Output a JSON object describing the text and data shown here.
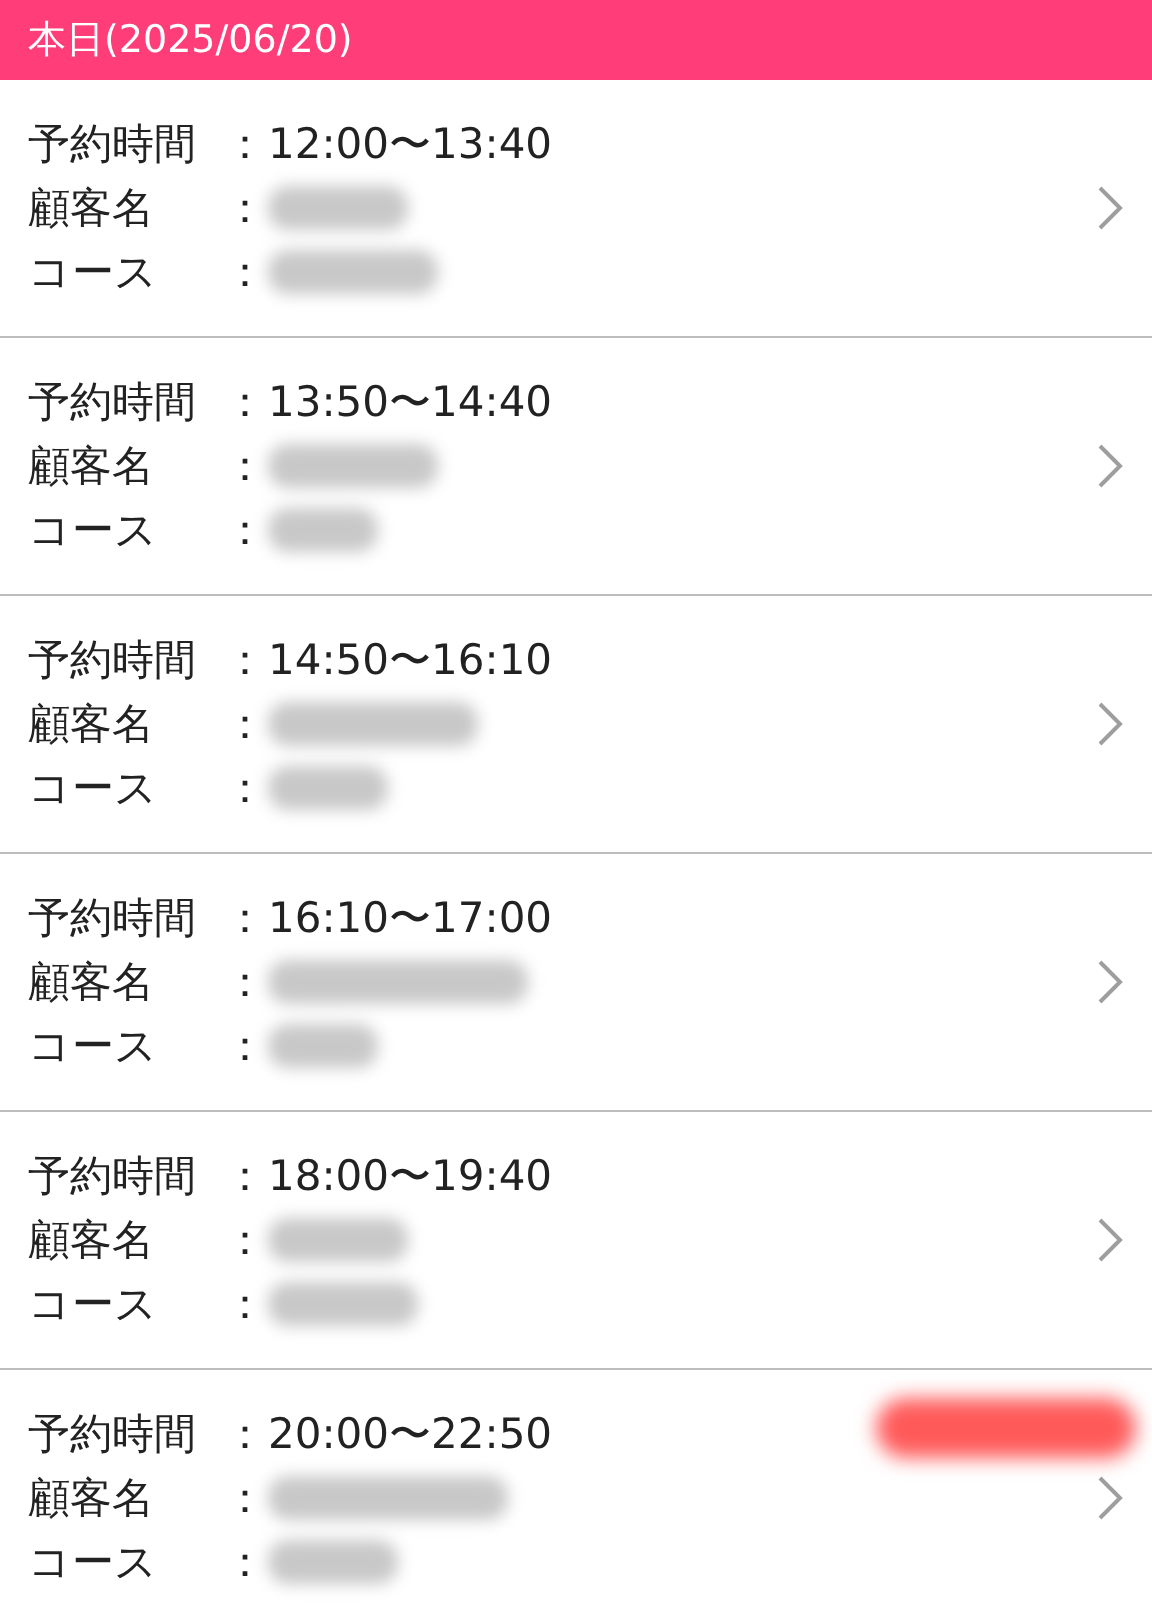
{
  "header": {
    "title": "本日(2025/06/20)"
  },
  "reservations": [
    {
      "time_label": "予約時間",
      "colon": "：",
      "time": "12:00〜13:40",
      "name_label": "顧客名",
      "course_label": "コース",
      "has_badge": false
    },
    {
      "time_label": "予約時間",
      "colon": "：",
      "time": "13:50〜14:40",
      "name_label": "顧客名",
      "course_label": "コース",
      "has_badge": false
    },
    {
      "time_label": "予約時間",
      "colon": "：",
      "time": "14:50〜16:10",
      "name_label": "顧客名",
      "course_label": "コース",
      "has_badge": false
    },
    {
      "time_label": "予約時間",
      "colon": "：",
      "time": "16:10〜17:00",
      "name_label": "顧客名",
      "course_label": "コース",
      "has_badge": false
    },
    {
      "time_label": "予約時間",
      "colon": "：",
      "time": "18:00〜19:40",
      "name_label": "顧客名",
      "course_label": "コース",
      "has_badge": false
    },
    {
      "time_label": "予約時間",
      "colon": "：",
      "time": "20:00〜22:50",
      "name_label": "顧客名",
      "course_label": "コース",
      "has_badge": true
    }
  ]
}
